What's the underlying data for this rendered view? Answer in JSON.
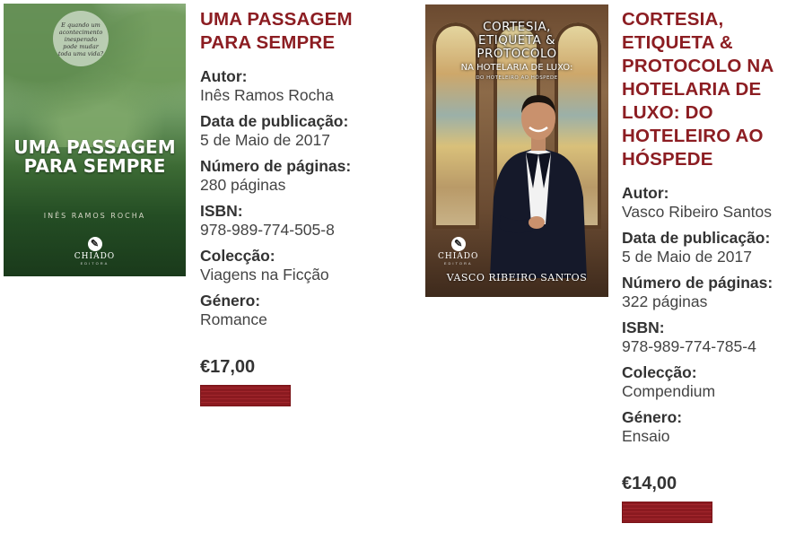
{
  "books": [
    {
      "title": "UMA PASSAGEM PARA SEMPRE",
      "cover": {
        "tagline": "E quando um acontecimento inesperado pode mudar toda uma vida?",
        "title": "UMA PASSAGEM PARA SEMPRE",
        "author": "INÊS RAMOS ROCHA",
        "publisher": "CHIADO",
        "publisher_sub": "EDITORA"
      },
      "fields": [
        {
          "label": "Autor:",
          "value": "Inês Ramos Rocha"
        },
        {
          "label": "Data de publicação:",
          "value": "5 de Maio de 2017"
        },
        {
          "label": "Número de páginas:",
          "value": "280 páginas"
        },
        {
          "label": "ISBN:",
          "value": "978-989-774-505-8"
        },
        {
          "label": "Colecção:",
          "value": "Viagens na Ficção"
        },
        {
          "label": "Género:",
          "value": "Romance"
        }
      ],
      "price": "€17,00"
    },
    {
      "title": "CORTESIA, ETIQUETA & PROTOCOLO NA HOTELARIA DE LUXO: DO HOTELEIRO AO HÓSPEDE",
      "cover": {
        "title": "CORTESIA, ETIQUETA & PROTOCOLO",
        "subtitle": "NA HOTELARIA DE LUXO:",
        "subtitle2": "DO HOTELEIRO AO HÓSPEDE",
        "author": "VASCO RIBEIRO SANTOS",
        "publisher": "CHIADO",
        "publisher_sub": "EDITORA"
      },
      "fields": [
        {
          "label": "Autor:",
          "value": "Vasco Ribeiro Santos"
        },
        {
          "label": "Data de publicação:",
          "value": "5 de Maio de 2017"
        },
        {
          "label": "Número de páginas:",
          "value": "322 páginas"
        },
        {
          "label": "ISBN:",
          "value": "978-989-774-785-4"
        },
        {
          "label": "Colecção:",
          "value": "Compendium"
        },
        {
          "label": "Género:",
          "value": "Ensaio"
        }
      ],
      "price": "€14,00"
    }
  ],
  "colors": {
    "title": "#8c1d22",
    "buy_button": "#8b1a20"
  },
  "icons": {
    "buy_button": "add-to-cart-button"
  }
}
